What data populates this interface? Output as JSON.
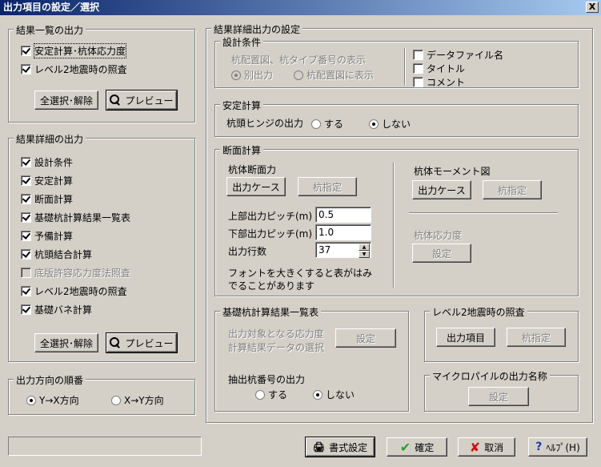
{
  "window": {
    "title": "出力項目の設定／選択",
    "close": "X"
  },
  "list_output": {
    "legend": "結果一覧の出力",
    "items": [
      {
        "label": "安定計算･杭体応力度",
        "checked": true
      },
      {
        "label": "レベル2地震時の照査",
        "checked": true
      }
    ],
    "select_all": "全選択･解除",
    "preview": "プレビュー"
  },
  "detail_output": {
    "legend": "結果詳細の出力",
    "items": [
      {
        "label": "設計条件",
        "checked": true
      },
      {
        "label": "安定計算",
        "checked": true
      },
      {
        "label": "断面計算",
        "checked": true
      },
      {
        "label": "基礎杭計算結果一覧表",
        "checked": true
      },
      {
        "label": "予備計算",
        "checked": true
      },
      {
        "label": "杭頭結合計算",
        "checked": true
      },
      {
        "label": "底版許容応力度法照査",
        "checked": false,
        "disabled": true
      },
      {
        "label": "レベル2地震時の照査",
        "checked": true
      },
      {
        "label": "基礎バネ計算",
        "checked": true
      }
    ],
    "select_all": "全選択･解除",
    "preview": "プレビュー"
  },
  "direction": {
    "legend": "出力方向の順番",
    "options": [
      "Y→X方向",
      "X→Y方向"
    ],
    "selected": 0
  },
  "detail_settings": {
    "legend": "結果詳細出力の設定",
    "design": {
      "legend": "設計条件",
      "pile_layout_label": "杭配置図、杭タイプ番号の表示",
      "options": [
        "別出力",
        "杭配置図に表示"
      ],
      "checks": [
        "データファイル名",
        "タイトル",
        "コメント"
      ]
    },
    "stability": {
      "legend": "安定計算",
      "hinge_label": "杭頭ヒンジの出力",
      "options": [
        "する",
        "しない"
      ],
      "selected": 1
    },
    "section": {
      "legend": "断面計算",
      "force_label": "杭体断面力",
      "output_case": "出力ケース",
      "pile_select": "杭指定",
      "moment_label": "杭体モーメント図",
      "moment_output_case": "出力ケース",
      "moment_pile_select": "杭指定",
      "upper_pitch_label": "上部出力ピッチ(m)",
      "upper_pitch": "0.5",
      "lower_pitch_label": "下部出力ピッチ(m)",
      "lower_pitch": "1.0",
      "rows_label": "出力行数",
      "rows": "37",
      "note": "フォントを大きくすると表がはみでることがあります",
      "stress_label": "杭体応力度",
      "stress_setting": "設定"
    },
    "summary": {
      "legend": "基礎杭計算結果一覧表",
      "target_line1": "出力対象となる応力度",
      "target_line2": "計算結果データの選択",
      "setting": "設定",
      "extract_label": "抽出杭番号の出力",
      "options": [
        "する",
        "しない"
      ],
      "selected": 1
    },
    "level2": {
      "legend": "レベル2地震時の照査",
      "output_items": "出力項目",
      "pile_select": "杭指定"
    },
    "micropile": {
      "legend": "マイクロパイルの出力名称",
      "setting": "設定"
    }
  },
  "footer": {
    "format": "書式設定",
    "ok": "確定",
    "cancel": "取消",
    "help": "ﾍﾙﾌﾟ(H)"
  }
}
